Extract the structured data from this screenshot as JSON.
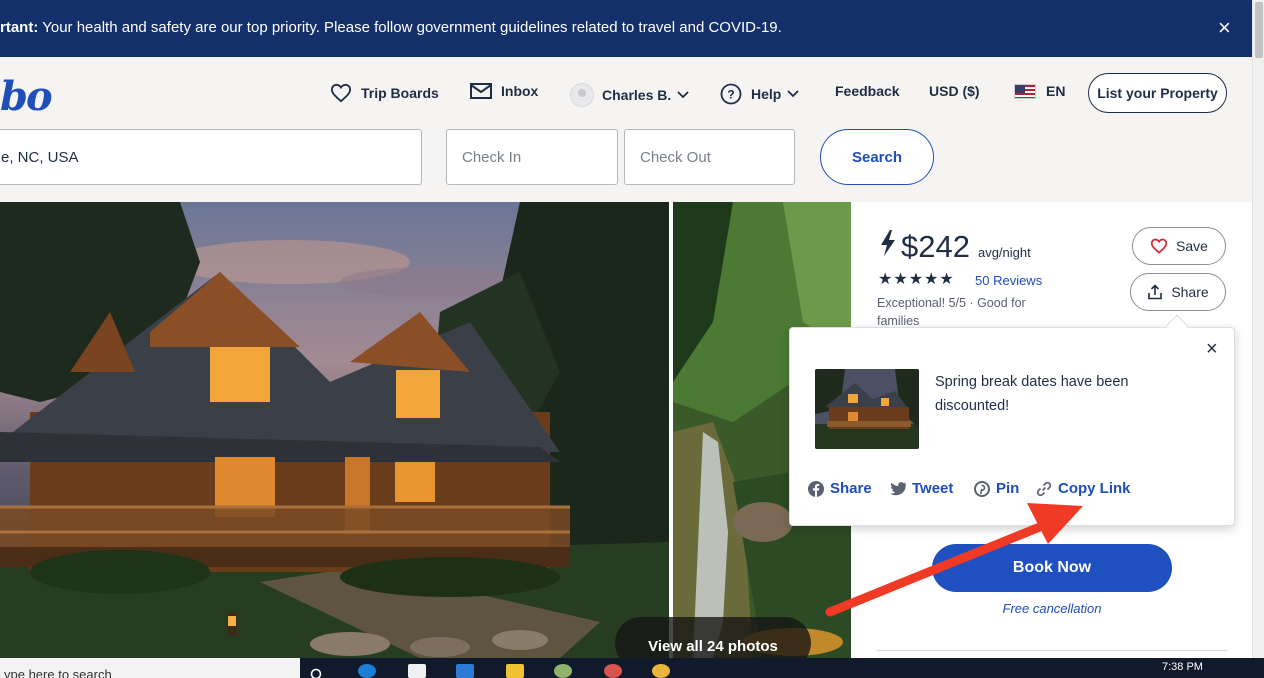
{
  "banner": {
    "label": "rtant:",
    "message": " Your health and safety are our top priority. Please follow government guidelines related to travel and COVID-19.",
    "close_glyph": "×"
  },
  "header": {
    "logo_text": "bo",
    "nav": {
      "trip_boards": "Trip Boards",
      "inbox": "Inbox",
      "user": "Charles B.",
      "help": "Help",
      "feedback": "Feedback",
      "currency": "USD ($)",
      "language": "EN"
    },
    "list_property": "List your Property"
  },
  "search": {
    "destination_value": "e, NC, USA",
    "check_in_placeholder": "Check In",
    "check_out_placeholder": "Check Out",
    "search_label": "Search"
  },
  "photos": {
    "view_all_label": "View all 24 photos"
  },
  "listing": {
    "price": "$242",
    "price_unit": "avg/night",
    "stars": "★★★★★",
    "rating_value": 5,
    "reviews_label": "50 Reviews",
    "rating_text": "Exceptional! 5/5",
    "separator": " · ",
    "family_text": "Good for families",
    "save_label": "Save",
    "share_label": "Share",
    "book_now_label": "Book Now",
    "free_cancellation": "Free cancellation"
  },
  "share_popup": {
    "message": "Spring break dates have been discounted!",
    "close_glyph": "×",
    "links": {
      "facebook": "Share",
      "twitter": "Tweet",
      "pinterest": "Pin",
      "copy": "Copy Link"
    }
  },
  "taskbar": {
    "search_placeholder": "ype here to search",
    "time": "7:38 PM"
  },
  "colors": {
    "banner_bg": "#13306b",
    "brand_blue": "#1f4eb8",
    "book_button": "#2050bf",
    "annotation_red": "#f03a25"
  }
}
